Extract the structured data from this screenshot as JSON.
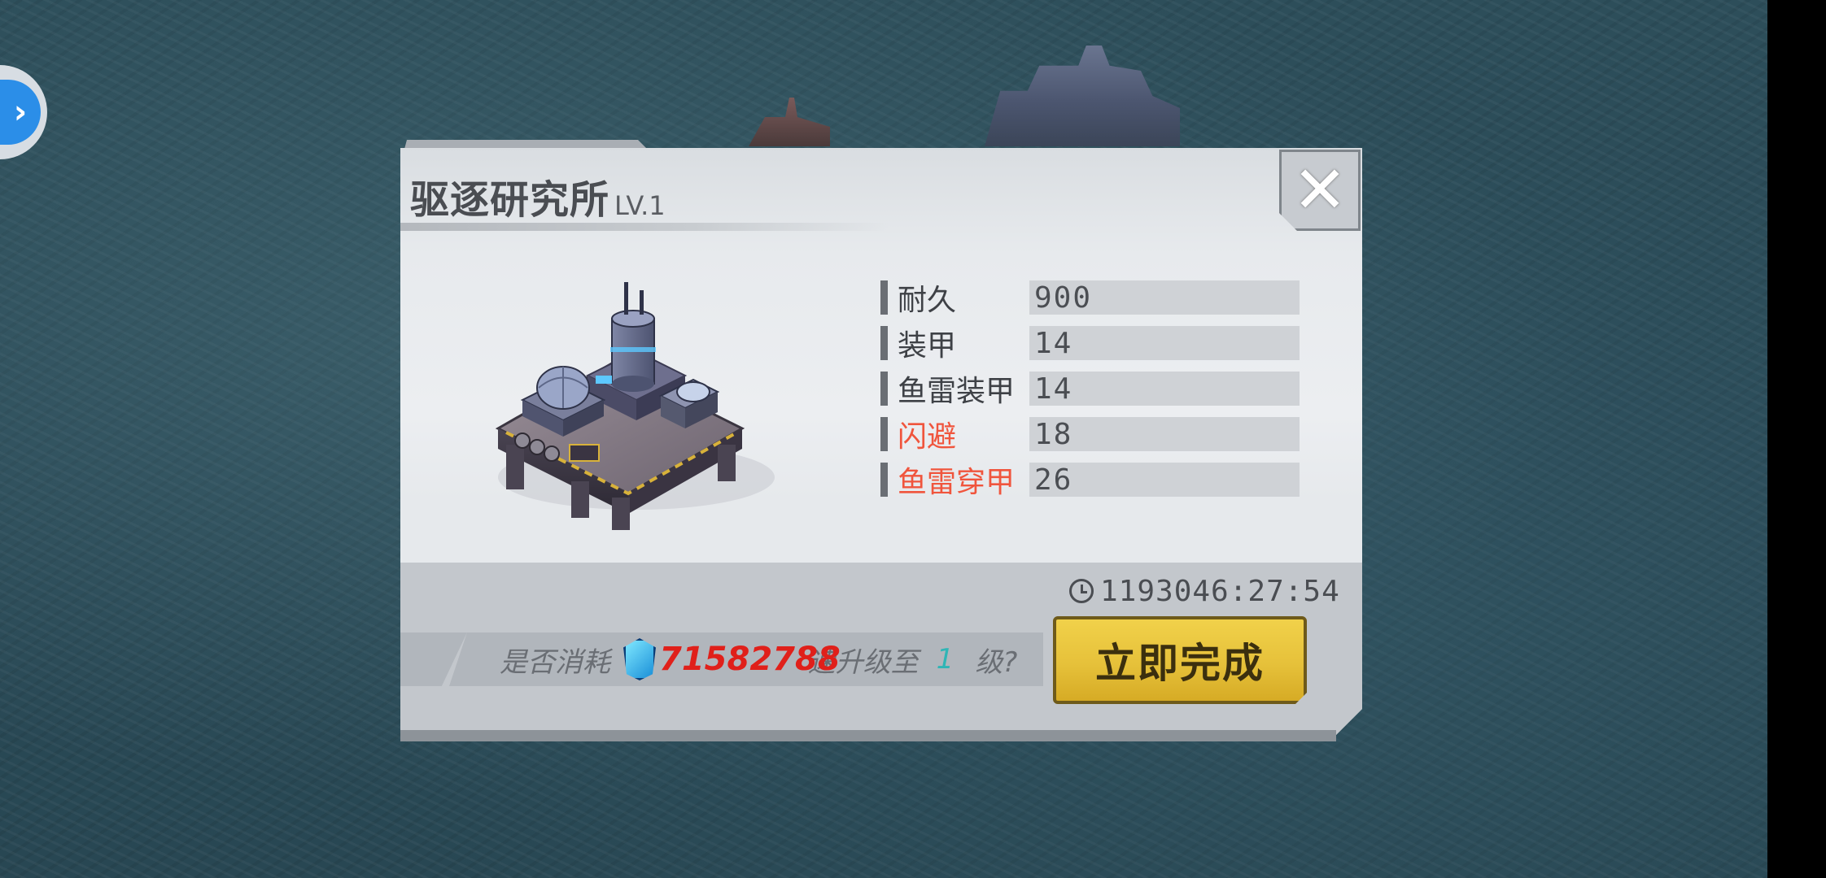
{
  "dialog": {
    "title": "驱逐研究所",
    "level": "LV.1",
    "close_glyph": "✕"
  },
  "stats": [
    {
      "label": "耐久",
      "value": "900",
      "highlight": false
    },
    {
      "label": "装甲",
      "value": "14",
      "highlight": false
    },
    {
      "label": "鱼雷装甲",
      "value": "14",
      "highlight": false
    },
    {
      "label": "闪避",
      "value": "18",
      "highlight": true
    },
    {
      "label": "鱼雷穿甲",
      "value": "26",
      "highlight": true
    }
  ],
  "timer": "1193046:27:54",
  "consume": {
    "prefix": "是否消耗",
    "cost": "71582788",
    "middle": "速升级至",
    "level": "1",
    "suffix": "级?"
  },
  "finish_button": "立即完成",
  "side_button_glyph": "›",
  "icons": {
    "side": "chevron-right-icon",
    "close": "close-icon",
    "timer": "clock-icon",
    "gem": "diamond-gem-icon"
  },
  "colors": {
    "sea": "#2b4b57",
    "highlight_label": "#f0553d",
    "cost": "#e0201a",
    "button": "#e6c13a"
  }
}
